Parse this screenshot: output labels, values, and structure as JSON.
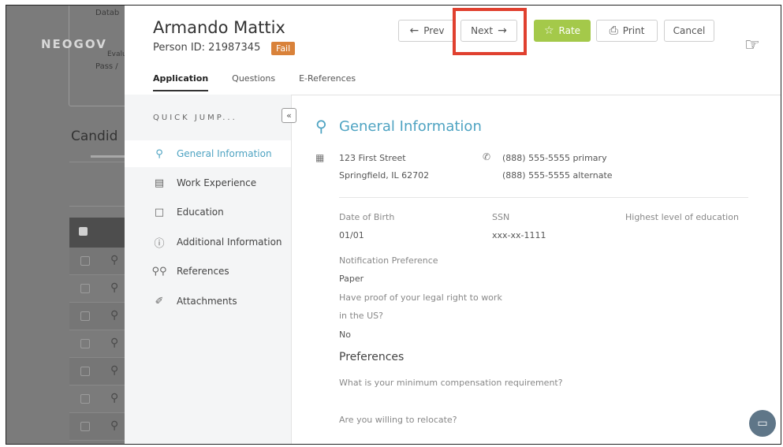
{
  "background": {
    "brand": "NEOGOV",
    "db_text": "Datab",
    "eval_text": "Evalua",
    "pass_text": "Pass /",
    "candidates_title": "Candid"
  },
  "header": {
    "name": "Armando Mattix",
    "person_id": "Person ID: 21987345",
    "status": "Fail",
    "tabs": [
      "Application",
      "Questions",
      "E-References"
    ],
    "buttons": {
      "prev": "Prev",
      "next": "Next",
      "rate": "Rate",
      "print": "Print",
      "cancel": "Cancel"
    }
  },
  "nav": {
    "quick_jump": "QUICK JUMP...",
    "items": [
      "General Information",
      "Work Experience",
      "Education",
      "Additional Information",
      "References",
      "Attachments"
    ]
  },
  "general": {
    "title": "General Information",
    "address_line1": "123 First Street",
    "address_line2": "Springfield, IL 62702",
    "phone_primary": "(888) 555-5555 primary",
    "phone_alternate": "(888) 555-5555 alternate",
    "dob_label": "Date of Birth",
    "dob_value": "01/01",
    "ssn_label": "SSN",
    "ssn_value": "xxx-xx-1111",
    "education_label": "Highest level of education",
    "notification_label": "Notification Preference",
    "notification_value": "Paper",
    "legal_label_line1": "Have proof of your legal right to work",
    "legal_label_line2": "in the US?",
    "legal_value": "No"
  },
  "preferences": {
    "title": "Preferences",
    "q1": "What is your minimum compensation requirement?",
    "q2": "Are you willing to relocate?"
  },
  "colors": {
    "accent": "#4ea3c2",
    "rate_green": "#a4c94a",
    "fail_orange": "#d9823a",
    "highlight_red": "#e0402f"
  }
}
